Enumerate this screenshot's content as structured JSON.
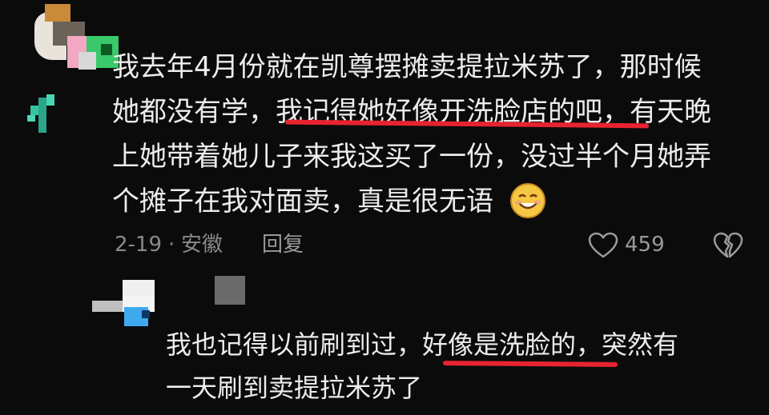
{
  "comment": {
    "lines": [
      "我去年4月份就在凯尊摆摊卖提拉米苏了，那时候",
      "她都没有学，",
      "我记得她好像开洗脸店的吧，",
      "有天晚",
      "上她带着她儿子来我这买了一份，没过半个月她弄",
      "个摊子在我对面卖，真是很无语"
    ],
    "date": "2-19",
    "location": "安徽",
    "reply_label": "回复",
    "like_count": "459",
    "emoji_icon": "smile-emoji-icon"
  },
  "reply": {
    "line1_pre": "我也记得以前刷到过，",
    "line1_hl": "好像是洗脸的",
    "line1_post": "，突然有",
    "line2": "一天刷到卖提拉米苏了"
  },
  "colors": {
    "background": "#0b0b0b",
    "text": "#ececec",
    "meta": "#8a8a8a",
    "underline": "#e8232f"
  }
}
